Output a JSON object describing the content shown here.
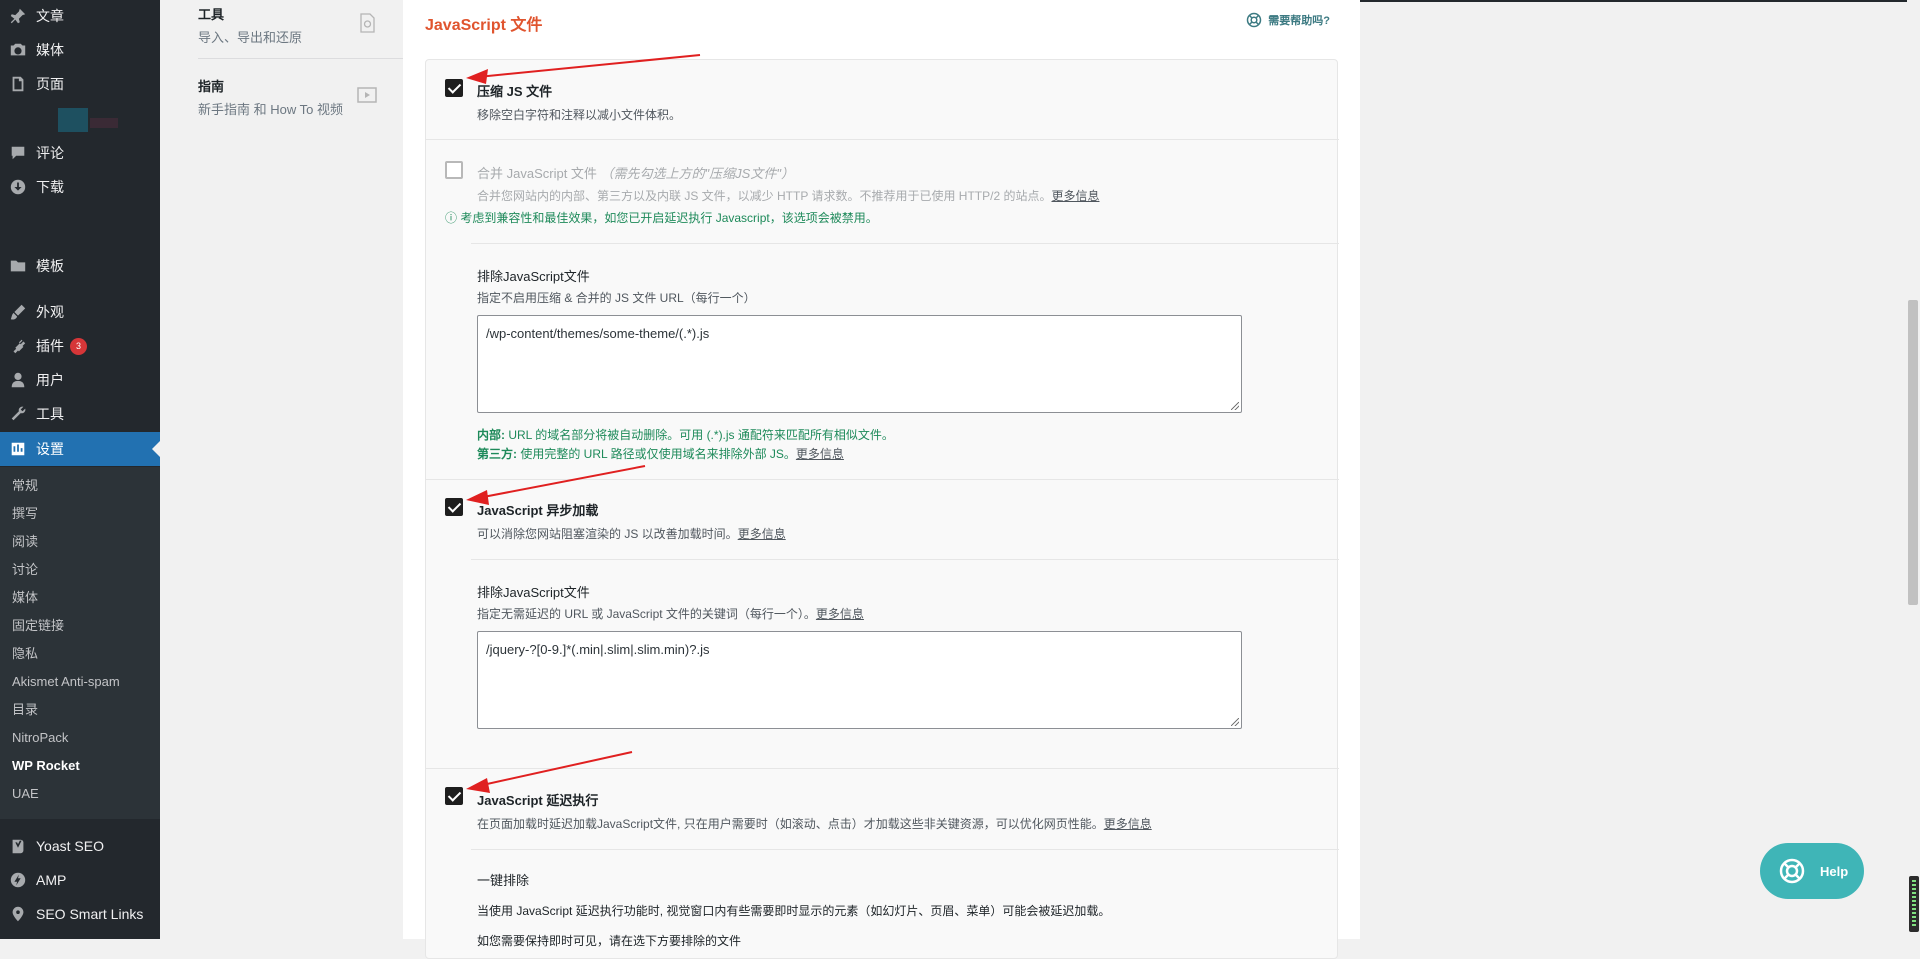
{
  "sidebar": {
    "items": [
      {
        "label": "文章",
        "icon": "pin-icon"
      },
      {
        "label": "媒体",
        "icon": "media-icon"
      },
      {
        "label": "页面",
        "icon": "page-icon"
      },
      {
        "label": "评论",
        "icon": "comment-icon"
      },
      {
        "label": "下载",
        "icon": "download-icon"
      },
      {
        "label": "模板",
        "icon": "folder-icon"
      },
      {
        "label": "外观",
        "icon": "brush-icon"
      },
      {
        "label": "插件",
        "icon": "plugin-icon",
        "badge": "3"
      },
      {
        "label": "用户",
        "icon": "user-icon"
      },
      {
        "label": "工具",
        "icon": "wrench-icon"
      },
      {
        "label": "设置",
        "icon": "settings-icon",
        "current": true
      },
      {
        "label": "Yoast SEO",
        "icon": "yoast-icon"
      },
      {
        "label": "AMP",
        "icon": "amp-icon"
      },
      {
        "label": "SEO Smart Links",
        "icon": "location-icon"
      }
    ],
    "submenu": [
      "常规",
      "撰写",
      "阅读",
      "讨论",
      "媒体",
      "固定链接",
      "隐私",
      "Akismet Anti-spam",
      "目录",
      "NitroPack",
      "WP Rocket",
      "UAE"
    ],
    "submenu_active": "WP Rocket"
  },
  "rocket_nav": {
    "tools": {
      "title": "工具",
      "subtitle": "导入、导出和还原"
    },
    "tutorials": {
      "title": "指南",
      "subtitle": "新手指南 和 How To 视频"
    }
  },
  "main": {
    "section_title": "JavaScript 文件",
    "help_link": "需要帮助吗?",
    "minify": {
      "label": "压缩 JS 文件",
      "checked": true,
      "desc": "移除空白字符和注释以减小文件体积。"
    },
    "combine": {
      "label": "合并 JavaScript 文件",
      "note": "（需先勾选上方的\"压缩JS文件\"）",
      "checked": false,
      "disabled": true,
      "desc": "合并您网站内的内部、第三方以及内联 JS 文件，以减少 HTTP 请求数。不推荐用于已使用 HTTP/2 的站点。",
      "more": "更多信息",
      "warning": "考虑到兼容性和最佳效果，如您已开启延迟执行 Javascript，该选项会被禁用。"
    },
    "exclude_js": {
      "title": "排除JavaScript文件",
      "desc": "指定不启用压缩 & 合并的 JS 文件 URL（每行一个）",
      "value": "/wp-content/themes/some-theme/(.*).js",
      "note1_label": "内部:",
      "note1": " URL 的域名部分将被自动删除。可用 (.*).js 通配符来匹配所有相似文件。",
      "note2_label": "第三方:",
      "note2": " 使用完整的 URL 路径或仅使用域名来排除外部 JS。",
      "note2_more": "更多信息"
    },
    "async": {
      "label": "JavaScript 异步加载",
      "checked": true,
      "desc": "可以消除您网站阻塞渲染的 JS 以改善加载时间。",
      "more": "更多信息"
    },
    "exclude_defer": {
      "title": "排除JavaScript文件",
      "desc": "指定无需延迟的 URL 或 JavaScript 文件的关键词（每行一个）。",
      "more": "更多信息",
      "value": "/jquery-?[0-9.]*(.min|.slim|.slim.min)?.js"
    },
    "delay": {
      "label": "JavaScript 延迟执行",
      "checked": true,
      "desc": "在页面加载时延迟加载JavaScript文件, 只在用户需要时（如滚动、点击）才加载这些非关键资源，可以优化网页性能。",
      "more": "更多信息"
    },
    "one_click": {
      "title": "一键排除",
      "desc": "当使用 JavaScript 延迟执行功能时, 视觉窗口内有些需要即时显示的元素（如幻灯片、页眉、菜单）可能会被延迟加载。",
      "cut_line": "如您需要保持即时可见，请在选下方要排除的文件"
    }
  },
  "help_button": "Help",
  "colors": {
    "accent": "#e0542e",
    "wp_blue": "#2271b1",
    "help_teal": "#3fb5b7",
    "arrow_red": "#e02020"
  }
}
